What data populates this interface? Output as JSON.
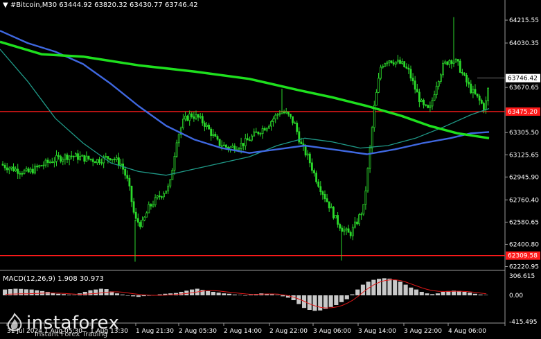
{
  "header": {
    "symbol_line": "#Bitcoin,M30  63444.92 63820.32 63430.77 63746.42"
  },
  "macd": {
    "label": "MACD(12,26,9) 1.908 30.973",
    "ticks": [
      "306.615",
      "0.00",
      "-415.495"
    ]
  },
  "price_axis": {
    "ticks": [
      "64215.55",
      "64030.35",
      "63670.65",
      "63305.50",
      "63125.65",
      "62945.90",
      "62760.40",
      "62580.65",
      "62400.80",
      "62220.95"
    ],
    "current_price": "63746.42",
    "level_upper": "63475.20",
    "level_lower": "62309.58"
  },
  "time_axis": {
    "labels": [
      "31 Jul 2024",
      "1 Aug 05:30",
      "1 Aug 13:30",
      "1 Aug 21:30",
      "2 Aug 05:30",
      "2 Aug 14:00",
      "2 Aug 22:00",
      "3 Aug 06:00",
      "3 Aug 14:00",
      "3 Aug 22:00",
      "4 Aug 06:00"
    ]
  },
  "branding": {
    "logo_text": "instaforex",
    "logo_sub": "Instant Forex Trading"
  },
  "colors": {
    "background": "#000000",
    "candle": "#2bd92b",
    "ma_fast": "#1f9a88",
    "ma_mid": "#3f68e0",
    "ma_slow": "#1ee01e",
    "level_line": "#ff1a1a",
    "macd_hist": "#c8c8c8",
    "macd_signal": "#e01818",
    "axis": "#9a9a9a"
  },
  "chart_data": {
    "type": "candlestick",
    "symbol": "#Bitcoin",
    "timeframe": "M30",
    "ylim": [
      62190,
      64300
    ],
    "levels": [
      63475.2,
      62309.58
    ],
    "path": [
      [
        0,
        63050
      ],
      [
        20,
        63010
      ],
      [
        40,
        62980
      ],
      [
        60,
        63040
      ],
      [
        80,
        63090
      ],
      [
        100,
        63120
      ],
      [
        120,
        63100
      ],
      [
        140,
        63080
      ],
      [
        160,
        63110
      ],
      [
        175,
        63050
      ],
      [
        185,
        62900
      ],
      [
        195,
        62600
      ],
      [
        205,
        62560
      ],
      [
        215,
        62700
      ],
      [
        225,
        62760
      ],
      [
        235,
        62820
      ],
      [
        245,
        62870
      ],
      [
        255,
        63250
      ],
      [
        265,
        63400
      ],
      [
        275,
        63450
      ],
      [
        285,
        63430
      ],
      [
        295,
        63380
      ],
      [
        305,
        63300
      ],
      [
        315,
        63220
      ],
      [
        330,
        63180
      ],
      [
        345,
        63200
      ],
      [
        355,
        63230
      ],
      [
        370,
        63300
      ],
      [
        385,
        63360
      ],
      [
        395,
        63420
      ],
      [
        405,
        63480
      ],
      [
        415,
        63450
      ],
      [
        425,
        63380
      ],
      [
        435,
        63200
      ],
      [
        445,
        63100
      ],
      [
        455,
        62950
      ],
      [
        465,
        62830
      ],
      [
        475,
        62720
      ],
      [
        485,
        62600
      ],
      [
        495,
        62520
      ],
      [
        505,
        62480
      ],
      [
        515,
        62580
      ],
      [
        525,
        62700
      ],
      [
        532,
        63050
      ],
      [
        540,
        63500
      ],
      [
        550,
        63850
      ],
      [
        560,
        63900
      ],
      [
        570,
        63880
      ],
      [
        580,
        63860
      ],
      [
        590,
        63800
      ],
      [
        600,
        63650
      ],
      [
        610,
        63520
      ],
      [
        620,
        63480
      ],
      [
        630,
        63700
      ],
      [
        640,
        63850
      ],
      [
        650,
        63900
      ],
      [
        660,
        63870
      ],
      [
        670,
        63750
      ],
      [
        680,
        63650
      ],
      [
        690,
        63580
      ],
      [
        700,
        63500
      ],
      [
        706,
        63700
      ]
    ],
    "ma_fast": [
      [
        0,
        63980
      ],
      [
        40,
        63720
      ],
      [
        80,
        63420
      ],
      [
        120,
        63220
      ],
      [
        160,
        63060
      ],
      [
        200,
        62990
      ],
      [
        240,
        62960
      ],
      [
        280,
        63010
      ],
      [
        320,
        63060
      ],
      [
        360,
        63110
      ],
      [
        400,
        63200
      ],
      [
        440,
        63260
      ],
      [
        480,
        63230
      ],
      [
        520,
        63180
      ],
      [
        560,
        63200
      ],
      [
        600,
        63260
      ],
      [
        640,
        63350
      ],
      [
        680,
        63450
      ],
      [
        706,
        63500
      ]
    ],
    "ma_mid": [
      [
        0,
        64130
      ],
      [
        40,
        64030
      ],
      [
        80,
        63960
      ],
      [
        120,
        63860
      ],
      [
        160,
        63700
      ],
      [
        200,
        63520
      ],
      [
        240,
        63360
      ],
      [
        280,
        63250
      ],
      [
        320,
        63180
      ],
      [
        360,
        63140
      ],
      [
        400,
        63170
      ],
      [
        440,
        63200
      ],
      [
        480,
        63170
      ],
      [
        530,
        63130
      ],
      [
        570,
        63170
      ],
      [
        610,
        63220
      ],
      [
        650,
        63260
      ],
      [
        680,
        63300
      ],
      [
        706,
        63310
      ]
    ],
    "ma_slow": [
      [
        0,
        64040
      ],
      [
        60,
        63940
      ],
      [
        120,
        63920
      ],
      [
        200,
        63850
      ],
      [
        280,
        63800
      ],
      [
        360,
        63740
      ],
      [
        430,
        63650
      ],
      [
        480,
        63590
      ],
      [
        530,
        63520
      ],
      [
        580,
        63440
      ],
      [
        620,
        63360
      ],
      [
        660,
        63300
      ],
      [
        706,
        63260
      ]
    ],
    "macd_hist": [
      0.3,
      0.32,
      0.34,
      0.33,
      0.31,
      0.3,
      0.26,
      0.22,
      0.18,
      0.12,
      0.08,
      0.06,
      0.03,
      0.02,
      0.1,
      0.18,
      0.26,
      0.3,
      0.34,
      0.32,
      0.2,
      0.1,
      0.04,
      -0.02,
      -0.05,
      -0.08,
      -0.04,
      -0.02,
      0.0,
      0.05,
      0.08,
      0.1,
      0.12,
      0.18,
      0.24,
      0.3,
      0.34,
      0.28,
      0.22,
      0.18,
      0.14,
      0.1,
      0.08,
      0.04,
      0.02,
      0.0,
      0.03,
      0.06,
      0.1,
      0.08,
      0.05,
      0.02,
      -0.05,
      -0.12,
      -0.25,
      -0.45,
      -0.65,
      -0.75,
      -0.8,
      -0.78,
      -0.7,
      -0.6,
      -0.5,
      -0.35,
      -0.2,
      0.05,
      0.3,
      0.55,
      0.7,
      0.8,
      0.85,
      0.88,
      0.86,
      0.8,
      0.7,
      0.55,
      0.4,
      0.3,
      0.18,
      0.1,
      0.06,
      0.1,
      0.18,
      0.22,
      0.24,
      0.22,
      0.18,
      0.14,
      0.08,
      0.04,
      0.02
    ],
    "macd_signal": [
      0.05,
      0.06,
      0.07,
      0.08,
      0.08,
      0.09,
      0.1,
      0.11,
      0.12,
      0.12,
      0.11,
      0.1,
      0.08,
      0.06,
      0.05,
      0.06,
      0.08,
      0.1,
      0.13,
      0.16,
      0.18,
      0.18,
      0.16,
      0.12,
      0.08,
      0.05,
      0.03,
      0.01,
      0.0,
      0.0,
      0.01,
      0.03,
      0.05,
      0.07,
      0.1,
      0.14,
      0.18,
      0.22,
      0.24,
      0.24,
      0.22,
      0.19,
      0.16,
      0.13,
      0.1,
      0.07,
      0.05,
      0.05,
      0.06,
      0.07,
      0.07,
      0.06,
      0.03,
      -0.02,
      -0.1,
      -0.2,
      -0.32,
      -0.45,
      -0.55,
      -0.62,
      -0.65,
      -0.64,
      -0.6,
      -0.52,
      -0.4,
      -0.25,
      -0.05,
      0.18,
      0.38,
      0.55,
      0.68,
      0.76,
      0.8,
      0.8,
      0.76,
      0.68,
      0.58,
      0.48,
      0.38,
      0.3,
      0.24,
      0.21,
      0.2,
      0.2,
      0.21,
      0.21,
      0.2,
      0.18,
      0.15,
      0.11,
      0.08
    ]
  }
}
